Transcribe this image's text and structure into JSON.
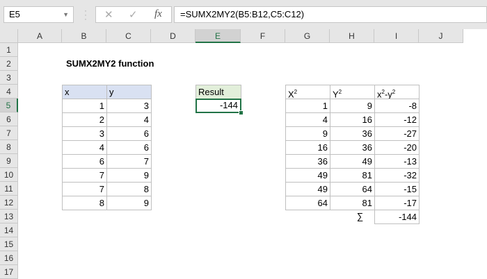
{
  "name_box": "E5",
  "formula_bar": {
    "cancel_icon": "✕",
    "enter_icon": "✓",
    "fx_icon": "fx",
    "formula": "=SUMX2MY2(B5:B12,C5:C12)"
  },
  "columns": [
    "A",
    "B",
    "C",
    "D",
    "E",
    "F",
    "G",
    "H",
    "I",
    "J"
  ],
  "rows": [
    "1",
    "2",
    "3",
    "4",
    "5",
    "6",
    "7",
    "8",
    "9",
    "10",
    "11",
    "12",
    "13",
    "14",
    "15",
    "16",
    "17"
  ],
  "selected": {
    "column": "E",
    "row": "5"
  },
  "title": "SUMX2MY2 function",
  "table_xy": {
    "headers": [
      "x",
      "y"
    ],
    "rows": [
      [
        1,
        3
      ],
      [
        2,
        4
      ],
      [
        3,
        6
      ],
      [
        4,
        6
      ],
      [
        6,
        7
      ],
      [
        7,
        9
      ],
      [
        7,
        8
      ],
      [
        8,
        9
      ]
    ]
  },
  "result": {
    "label": "Result",
    "value": "-144"
  },
  "table_sq": {
    "headers": [
      "X²",
      "Y²",
      "x²-y²"
    ],
    "rows": [
      [
        1,
        9,
        -8
      ],
      [
        4,
        16,
        -12
      ],
      [
        9,
        36,
        -27
      ],
      [
        16,
        36,
        -20
      ],
      [
        36,
        49,
        -13
      ],
      [
        49,
        81,
        -32
      ],
      [
        49,
        64,
        -15
      ],
      [
        64,
        81,
        -17
      ]
    ],
    "sum_symbol": "∑",
    "sum": "-144"
  },
  "colors": {
    "accent": "#217346",
    "header_blue": "#d9e1f2",
    "header_green": "#e2efda"
  }
}
